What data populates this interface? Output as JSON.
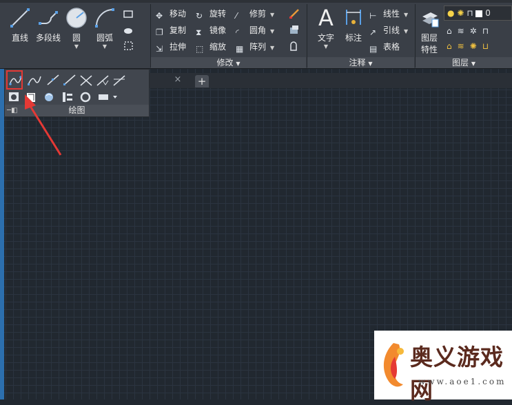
{
  "ribbon": {
    "draw": {
      "line_label": "直线",
      "polyline_label": "多段线",
      "circle_label": "圆",
      "arc_label": "圆弧"
    },
    "modify": {
      "title": "修改",
      "move_label": "移动",
      "rotate_label": "旋转",
      "trim_label": "修剪",
      "copy_label": "复制",
      "mirror_label": "镜像",
      "fillet_label": "圆角",
      "stretch_label": "拉伸",
      "scale_label": "缩放",
      "array_label": "阵列"
    },
    "annotation": {
      "title": "注释",
      "text_label": "文字",
      "dimension_label": "标注",
      "linear_label": "线性",
      "leader_label": "引线",
      "table_label": "表格"
    },
    "layers": {
      "title": "图层",
      "properties_label_line1": "图层",
      "properties_label_line2": "特性",
      "current_layer": "0"
    }
  },
  "draw_flyout": {
    "title": "绘图"
  },
  "tabs": {
    "close_symbol": "×",
    "add_symbol": "+"
  },
  "watermark": {
    "text": "奥义游戏网",
    "url": "www.aoe1.com"
  },
  "colors": {
    "highlight": "#e53935",
    "canvas": "#212830",
    "ribbon": "#3a3f47"
  }
}
